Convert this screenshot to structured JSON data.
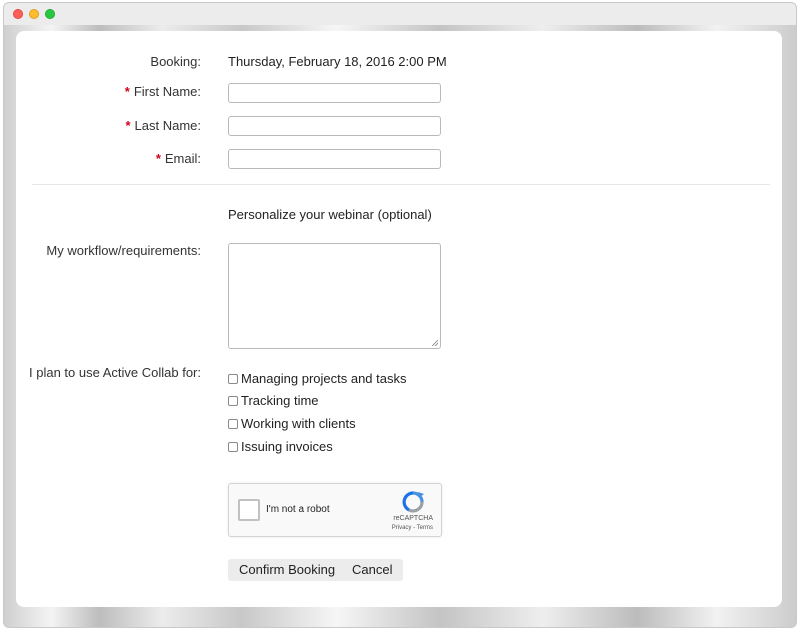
{
  "form": {
    "booking": {
      "label": "Booking:",
      "value": "Thursday, February 18, 2016 2:00 PM"
    },
    "required_marker": "*",
    "first_name": {
      "label": "First Name:",
      "value": ""
    },
    "last_name": {
      "label": "Last Name:",
      "value": ""
    },
    "email": {
      "label": "Email:",
      "value": ""
    },
    "personalize_heading": "Personalize your webinar (optional)",
    "workflow": {
      "label": "My workflow/requirements:",
      "value": ""
    },
    "usage": {
      "label": "I plan to use Active Collab for:",
      "options": [
        {
          "label": "Managing projects and tasks",
          "checked": false
        },
        {
          "label": "Tracking time",
          "checked": false
        },
        {
          "label": "Working with clients",
          "checked": false
        },
        {
          "label": "Issuing invoices",
          "checked": false
        }
      ]
    }
  },
  "captcha": {
    "label": "I'm not a robot",
    "brand": "reCAPTCHA",
    "links": "Privacy - Terms",
    "checked": false
  },
  "actions": {
    "confirm_label": "Confirm Booking",
    "cancel_label": "Cancel"
  },
  "colors": {
    "required": "#d0021b"
  },
  "icons": {
    "captcha_logo": "recaptcha-logo-icon",
    "resize": "resize-grip-icon"
  }
}
